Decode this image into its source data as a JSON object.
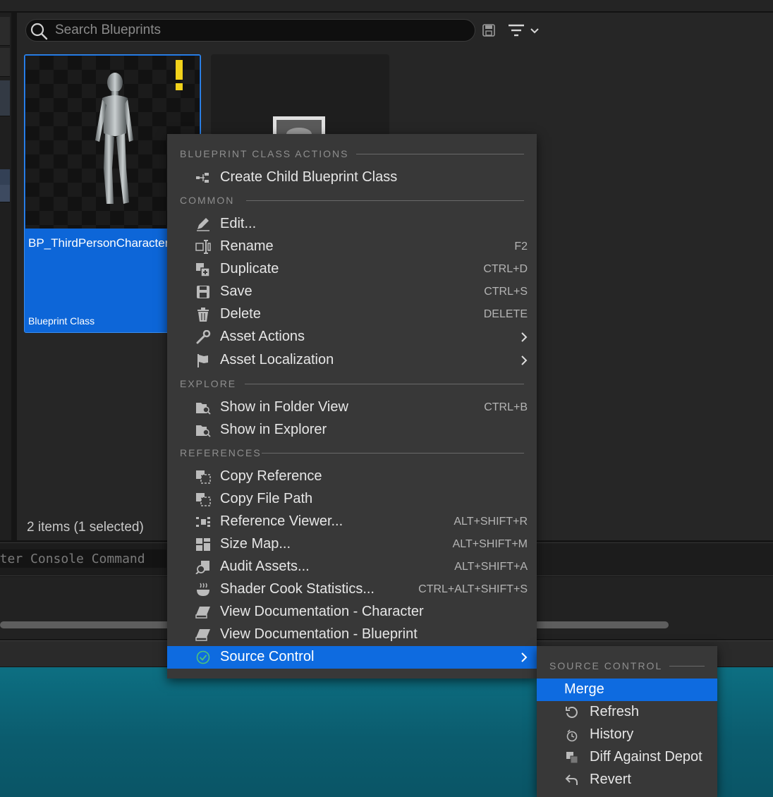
{
  "search": {
    "placeholder": "Search Blueprints"
  },
  "asset": {
    "name": "BP_ThirdPersonCharacter",
    "type": "Blueprint Class"
  },
  "status": {
    "items_count": "2 items (1 selected)"
  },
  "console": {
    "placeholder": "Enter Console Command"
  },
  "colors": {
    "accent": "#0e6be0",
    "menu_bg": "#383838",
    "panel_bg": "#262626",
    "warning": "#f2d21b"
  },
  "menu": {
    "sections": {
      "blueprint_class_actions": "BLUEPRINT CLASS ACTIONS",
      "common": "COMMON",
      "explore": "EXPLORE",
      "references": "REFERENCES"
    },
    "items": {
      "create_child": {
        "label": "Create Child Blueprint Class",
        "icon": "hierarchy-icon"
      },
      "edit": {
        "label": "Edit...",
        "icon": "pencil-icon"
      },
      "rename": {
        "label": "Rename",
        "shortcut": "F2",
        "icon": "rename-icon"
      },
      "duplicate": {
        "label": "Duplicate",
        "shortcut": "CTRL+D",
        "icon": "duplicate-icon"
      },
      "save": {
        "label": "Save",
        "shortcut": "CTRL+S",
        "icon": "save-icon"
      },
      "delete": {
        "label": "Delete",
        "shortcut": "DELETE",
        "icon": "trash-icon"
      },
      "asset_actions": {
        "label": "Asset Actions",
        "icon": "wrench-icon"
      },
      "asset_localization": {
        "label": "Asset Localization",
        "icon": "flag-icon"
      },
      "show_folder": {
        "label": "Show in Folder View",
        "shortcut": "CTRL+B",
        "icon": "folder-search-icon"
      },
      "show_explorer": {
        "label": "Show in Explorer",
        "icon": "folder-search-icon"
      },
      "copy_reference": {
        "label": "Copy Reference",
        "icon": "copy-icon"
      },
      "copy_path": {
        "label": "Copy File Path",
        "icon": "copy-icon"
      },
      "reference_viewer": {
        "label": "Reference Viewer...",
        "shortcut": "ALT+SHIFT+R",
        "icon": "reference-viewer-icon"
      },
      "size_map": {
        "label": "Size Map...",
        "shortcut": "ALT+SHIFT+M",
        "icon": "size-map-icon"
      },
      "audit_assets": {
        "label": "Audit Assets...",
        "shortcut": "ALT+SHIFT+A",
        "icon": "audit-icon"
      },
      "shader_cook": {
        "label": "Shader Cook Statistics...",
        "shortcut": "CTRL+ALT+SHIFT+S",
        "icon": "shader-icon"
      },
      "doc_character": {
        "label": "View Documentation - Character",
        "icon": "book-icon"
      },
      "doc_blueprint": {
        "label": "View Documentation - Blueprint",
        "icon": "book-icon"
      },
      "source_control": {
        "label": "Source Control",
        "icon": "check-circle-icon"
      }
    }
  },
  "submenu": {
    "section": "SOURCE CONTROL",
    "items": {
      "merge": {
        "label": "Merge"
      },
      "refresh": {
        "label": "Refresh",
        "icon": "refresh-icon"
      },
      "history": {
        "label": "History",
        "icon": "history-icon"
      },
      "diff": {
        "label": "Diff Against Depot",
        "icon": "diff-icon"
      },
      "revert": {
        "label": "Revert",
        "icon": "revert-icon"
      }
    }
  }
}
